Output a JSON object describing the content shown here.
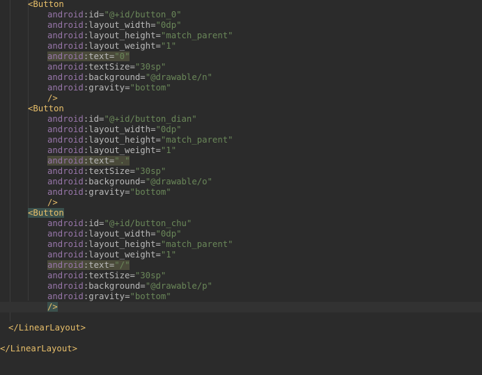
{
  "editor": {
    "language": "xml",
    "colors": {
      "background": "#2b2b2b",
      "tag": "#e8bf6a",
      "namespace": "#9876aa",
      "attribute": "#bababa",
      "value": "#6a8759",
      "current_line": "#323232"
    },
    "lines": [
      {
        "type": "open",
        "indent": 40,
        "tag": "Button",
        "match": true
      },
      {
        "type": "attr",
        "indent": 68,
        "ns": "android",
        "name": "id",
        "value": "\"@+id/button_0\""
      },
      {
        "type": "attr",
        "indent": 68,
        "ns": "android",
        "name": "layout_width",
        "value": "\"0dp\""
      },
      {
        "type": "attr",
        "indent": 68,
        "ns": "android",
        "name": "layout_height",
        "value": "\"match_parent\""
      },
      {
        "type": "attr",
        "indent": 68,
        "ns": "android",
        "name": "layout_weight",
        "value": "\"1\""
      },
      {
        "type": "attr",
        "indent": 68,
        "ns": "android",
        "name": "text",
        "value": "\"0\"",
        "highlight": true
      },
      {
        "type": "attr",
        "indent": 68,
        "ns": "android",
        "name": "textSize",
        "value": "\"30sp\""
      },
      {
        "type": "attr",
        "indent": 68,
        "ns": "android",
        "name": "background",
        "value": "\"@drawable/n\""
      },
      {
        "type": "attr",
        "indent": 68,
        "ns": "android",
        "name": "gravity",
        "value": "\"bottom\""
      },
      {
        "type": "close",
        "indent": 68,
        "text": "/>"
      },
      {
        "type": "open",
        "indent": 40,
        "tag": "Button",
        "match": true
      },
      {
        "type": "attr",
        "indent": 68,
        "ns": "android",
        "name": "id",
        "value": "\"@+id/button_dian\""
      },
      {
        "type": "attr",
        "indent": 68,
        "ns": "android",
        "name": "layout_width",
        "value": "\"0dp\""
      },
      {
        "type": "attr",
        "indent": 68,
        "ns": "android",
        "name": "layout_height",
        "value": "\"match_parent\""
      },
      {
        "type": "attr",
        "indent": 68,
        "ns": "android",
        "name": "layout_weight",
        "value": "\"1\""
      },
      {
        "type": "attr",
        "indent": 68,
        "ns": "android",
        "name": "text",
        "value": "\".\"",
        "highlight": true
      },
      {
        "type": "attr",
        "indent": 68,
        "ns": "android",
        "name": "textSize",
        "value": "\"30sp\""
      },
      {
        "type": "attr",
        "indent": 68,
        "ns": "android",
        "name": "background",
        "value": "\"@drawable/o\""
      },
      {
        "type": "attr",
        "indent": 68,
        "ns": "android",
        "name": "gravity",
        "value": "\"bottom\""
      },
      {
        "type": "close",
        "indent": 68,
        "text": "/>"
      },
      {
        "type": "open",
        "indent": 40,
        "tag": "Button",
        "match": true,
        "matchbg": true
      },
      {
        "type": "attr",
        "indent": 68,
        "ns": "android",
        "name": "id",
        "value": "\"@+id/button_chu\""
      },
      {
        "type": "attr",
        "indent": 68,
        "ns": "android",
        "name": "layout_width",
        "value": "\"0dp\""
      },
      {
        "type": "attr",
        "indent": 68,
        "ns": "android",
        "name": "layout_height",
        "value": "\"match_parent\""
      },
      {
        "type": "attr",
        "indent": 68,
        "ns": "android",
        "name": "layout_weight",
        "value": "\"1\""
      },
      {
        "type": "attr",
        "indent": 68,
        "ns": "android",
        "name": "text",
        "value": "\"/\"",
        "highlight": true
      },
      {
        "type": "attr",
        "indent": 68,
        "ns": "android",
        "name": "textSize",
        "value": "\"30sp\""
      },
      {
        "type": "attr",
        "indent": 68,
        "ns": "android",
        "name": "background",
        "value": "\"@drawable/p\""
      },
      {
        "type": "attr",
        "indent": 68,
        "ns": "android",
        "name": "gravity",
        "value": "\"bottom\""
      },
      {
        "type": "close",
        "indent": 68,
        "text": "/>",
        "current": true,
        "matchbg": true
      },
      {
        "type": "blank"
      },
      {
        "type": "endtag",
        "indent": 12,
        "text": "</LinearLayout>"
      },
      {
        "type": "blank"
      },
      {
        "type": "endtag",
        "indent": 0,
        "text": "</LinearLayout>"
      }
    ]
  }
}
